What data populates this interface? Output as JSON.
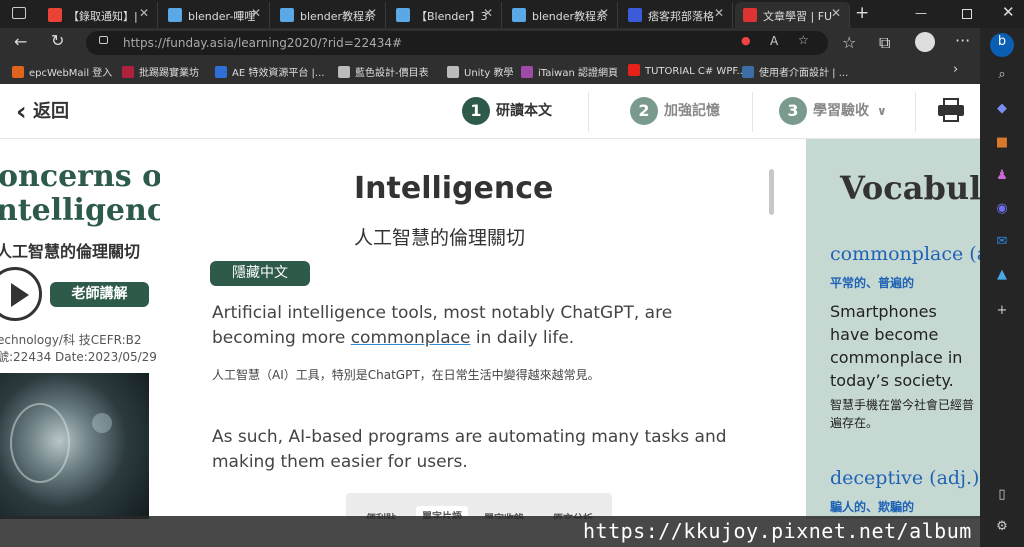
{
  "browser": {
    "tabs": [
      {
        "label": "【錄取通知】|",
        "icon": "gmail-icon",
        "color": "#ea4335"
      },
      {
        "label": "blender-嗶哩",
        "icon": "bilibili-icon",
        "color": "#5aa9e6"
      },
      {
        "label": "blender教程系",
        "icon": "bilibili-icon",
        "color": "#5aa9e6"
      },
      {
        "label": "【Blender】3",
        "icon": "bilibili-icon",
        "color": "#5aa9e6"
      },
      {
        "label": "blender教程系",
        "icon": "bilibili-icon",
        "color": "#5aa9e6"
      },
      {
        "label": "痞客邦部落格",
        "icon": "pixnet-icon",
        "color": "#3b5bdb"
      },
      {
        "label": "文章學習 | FU",
        "icon": "funday-icon",
        "color": "#d33"
      }
    ],
    "url": "https://funday.asia/learning2020/?rid=22434#",
    "bookmarks": [
      {
        "label": "epcWebMail 登入",
        "color": "#e0631d"
      },
      {
        "label": "批踢踢實業坊",
        "color": "#b0223b"
      },
      {
        "label": "AE 特效資源平台 |...",
        "color": "#2f6fd6"
      },
      {
        "label": "藍色設計-價目表",
        "color": "#bbbbbb"
      },
      {
        "label": "Unity 教學",
        "color": "#bbbbbb"
      },
      {
        "label": "iTaiwan 認證網頁",
        "color": "#a04aa8"
      },
      {
        "label": "TUTORIAL C# WPF...",
        "color": "#e62117"
      },
      {
        "label": "使用者介面設計 | ...",
        "color": "#3a6ea5"
      }
    ]
  },
  "nav": {
    "back_label": "返回",
    "steps": [
      {
        "num": "1",
        "label": "研讀本文",
        "active": true
      },
      {
        "num": "2",
        "label": "加強記憶",
        "active": false
      },
      {
        "num": "3",
        "label": "學習驗收",
        "active": false
      }
    ]
  },
  "left": {
    "title_line1": "oncerns of",
    "title_line2": "ntelligence",
    "subtitle": "人工智慧的倫理關切",
    "teacher_button": "老師講解",
    "meta1": "echnology/科 技CEFR:B2",
    "meta2": "號:22434 Date:2023/05/29"
  },
  "article": {
    "title": "Intelligence",
    "subtitle": "人工智慧的倫理關切",
    "hide_chinese": "隱藏中文",
    "p1_before": "Artificial intelligence tools, most notably ChatGPT, are becoming more ",
    "p1_link": "commonplace",
    "p1_after": " in daily life.",
    "p1_zh": "人工智慧（AI）工具，特別是ChatGPT，在日常生活中變得越來越常見。",
    "p2": "As such, AI-based programs are automating many tasks and making them easier for users.",
    "toolbar": [
      "便利貼",
      "單字片語",
      "單字收錄",
      "原文分析"
    ]
  },
  "vocab": {
    "heading": "Vocabula",
    "word1": "commonplace (a",
    "word1_zh": "平常的、普遍的",
    "example1": "Smartphones have become commonplace in today’s society.",
    "example1_zh": "智慧手機在當今社會已經普遍存在。",
    "word2": "deceptive (adj.)",
    "word2_zh": "騙人的、欺騙的"
  },
  "watermark": "https://kkujoy.pixnet.net/album"
}
